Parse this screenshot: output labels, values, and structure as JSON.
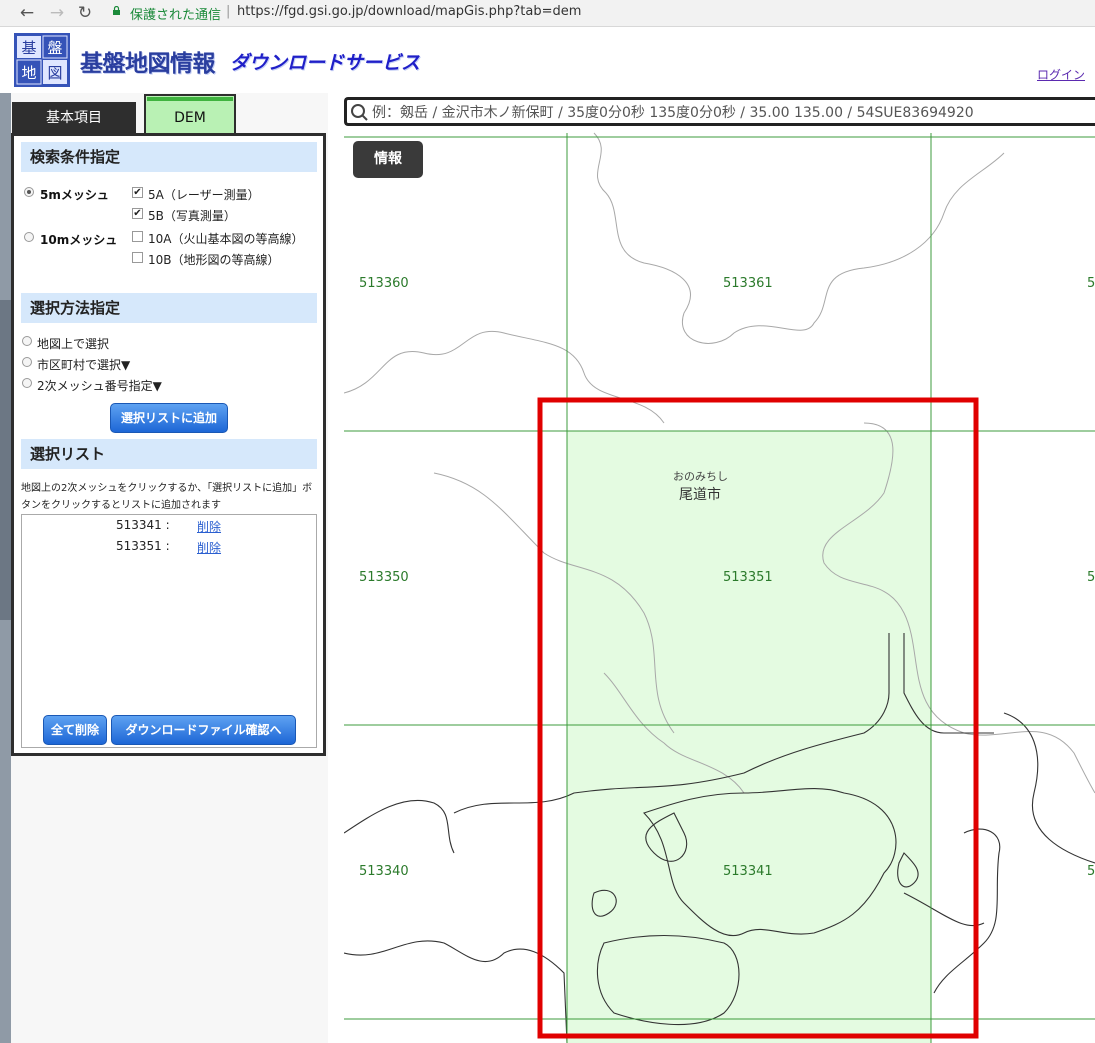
{
  "browser": {
    "secure_label": "保護された通信",
    "url": "https://fgd.gsi.go.jp/download/mapGis.php?tab=dem"
  },
  "header": {
    "logo_chars": [
      "基",
      "盤",
      "地",
      "図",
      "情",
      "報"
    ],
    "title": "基盤地図情報",
    "subtitle": "ダウンロードサービス",
    "login_label": "ログイン"
  },
  "tabs": [
    {
      "label": "基本項目",
      "selected": false
    },
    {
      "label": "DEM",
      "selected": true
    }
  ],
  "search_conditions": {
    "heading": "検索条件指定",
    "mesh_options": [
      {
        "label": "5mメッシュ",
        "selected": true
      },
      {
        "label": "10mメッシュ",
        "selected": false
      }
    ],
    "data_types": [
      {
        "label": "5A（レーザー測量）",
        "checked": true
      },
      {
        "label": "5B（写真測量）",
        "checked": true
      },
      {
        "label": "10A（火山基本図の等高線）",
        "checked": false
      },
      {
        "label": "10B（地形図の等高線）",
        "checked": false
      }
    ]
  },
  "selection_method": {
    "heading": "選択方法指定",
    "options": [
      {
        "label": "地図上で選択"
      },
      {
        "label": "市区町村で選択▼"
      },
      {
        "label": "2次メッシュ番号指定▼"
      }
    ],
    "add_button": "選択リストに追加"
  },
  "selection_list": {
    "heading": "選択リスト",
    "help": "地図上の2次メッシュをクリックするか、「選択リストに追加」ボタンをクリックするとリストに追加されます",
    "items": [
      {
        "code": "513341 :",
        "delete": "削除"
      },
      {
        "code": "513351 :",
        "delete": "削除"
      }
    ],
    "delete_all_button": "全て削除",
    "download_button": "ダウンロードファイル確認へ"
  },
  "map": {
    "search_placeholder": "例：剱岳 / 金沢市木ノ新保町 / 35度0分0秒 135度0分0秒 / 35.00 135.00 / 54SUE83694920",
    "info_button": "情報",
    "mesh_labels": [
      "513360",
      "513361",
      "513350",
      "513351",
      "513340",
      "513341",
      "5",
      "5",
      "5"
    ],
    "place_kana": "おのみちし",
    "place_name": "尾道市",
    "colors": {
      "grid": "#3c9b3c",
      "selected_fill": "#e4fbe1",
      "highlight_box": "#e00000"
    }
  }
}
